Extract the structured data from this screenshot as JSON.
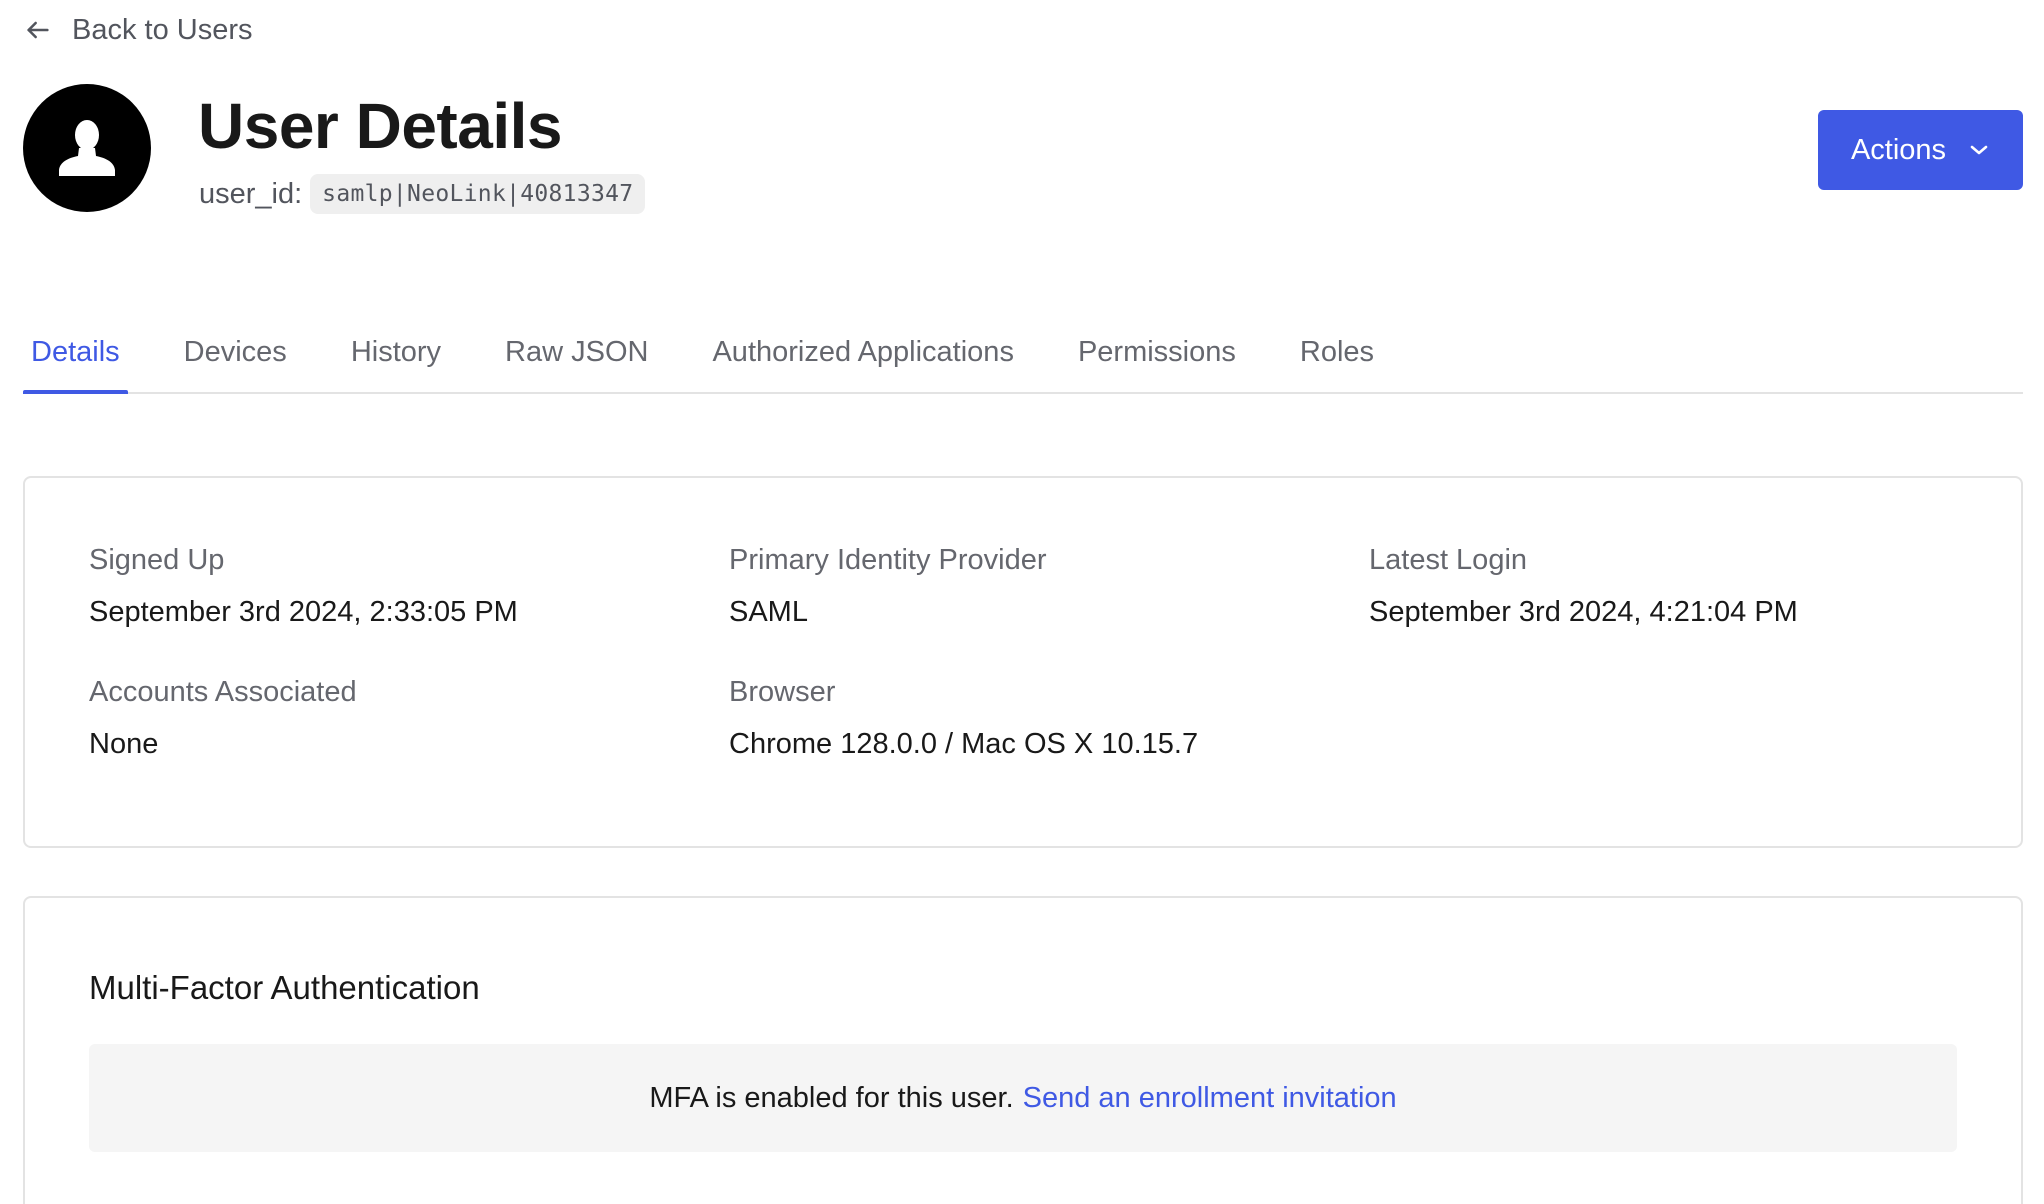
{
  "back_link": {
    "label": "Back to Users",
    "icon": "arrow-left-icon"
  },
  "header": {
    "avatar_icon": "user-silhouette-icon",
    "title": "User Details",
    "user_id_label": "user_id:",
    "user_id_value": "samlp|NeoLink|40813347",
    "actions_label": "Actions",
    "actions_icon": "chevron-down-icon"
  },
  "tabs": [
    {
      "label": "Details",
      "active": true
    },
    {
      "label": "Devices",
      "active": false
    },
    {
      "label": "History",
      "active": false
    },
    {
      "label": "Raw JSON",
      "active": false
    },
    {
      "label": "Authorized Applications",
      "active": false
    },
    {
      "label": "Permissions",
      "active": false
    },
    {
      "label": "Roles",
      "active": false
    }
  ],
  "details": {
    "signed_up": {
      "label": "Signed Up",
      "value": "September 3rd 2024, 2:33:05 PM"
    },
    "primary_identity_provider": {
      "label": "Primary Identity Provider",
      "value": "SAML"
    },
    "latest_login": {
      "label": "Latest Login",
      "value": "September 3rd 2024, 4:21:04 PM"
    },
    "accounts_associated": {
      "label": "Accounts Associated",
      "value": "None"
    },
    "browser": {
      "label": "Browser",
      "value": "Chrome 128.0.0 / Mac OS X 10.15.7"
    }
  },
  "mfa": {
    "title": "Multi-Factor Authentication",
    "status_text": "MFA is enabled for this user.",
    "link_label": "Send an enrollment invitation"
  },
  "colors": {
    "accent": "#3f59e4",
    "text_primary": "#191919",
    "text_secondary": "#65676e",
    "border": "#e3e3e3",
    "notice_background": "#f5f5f5"
  }
}
